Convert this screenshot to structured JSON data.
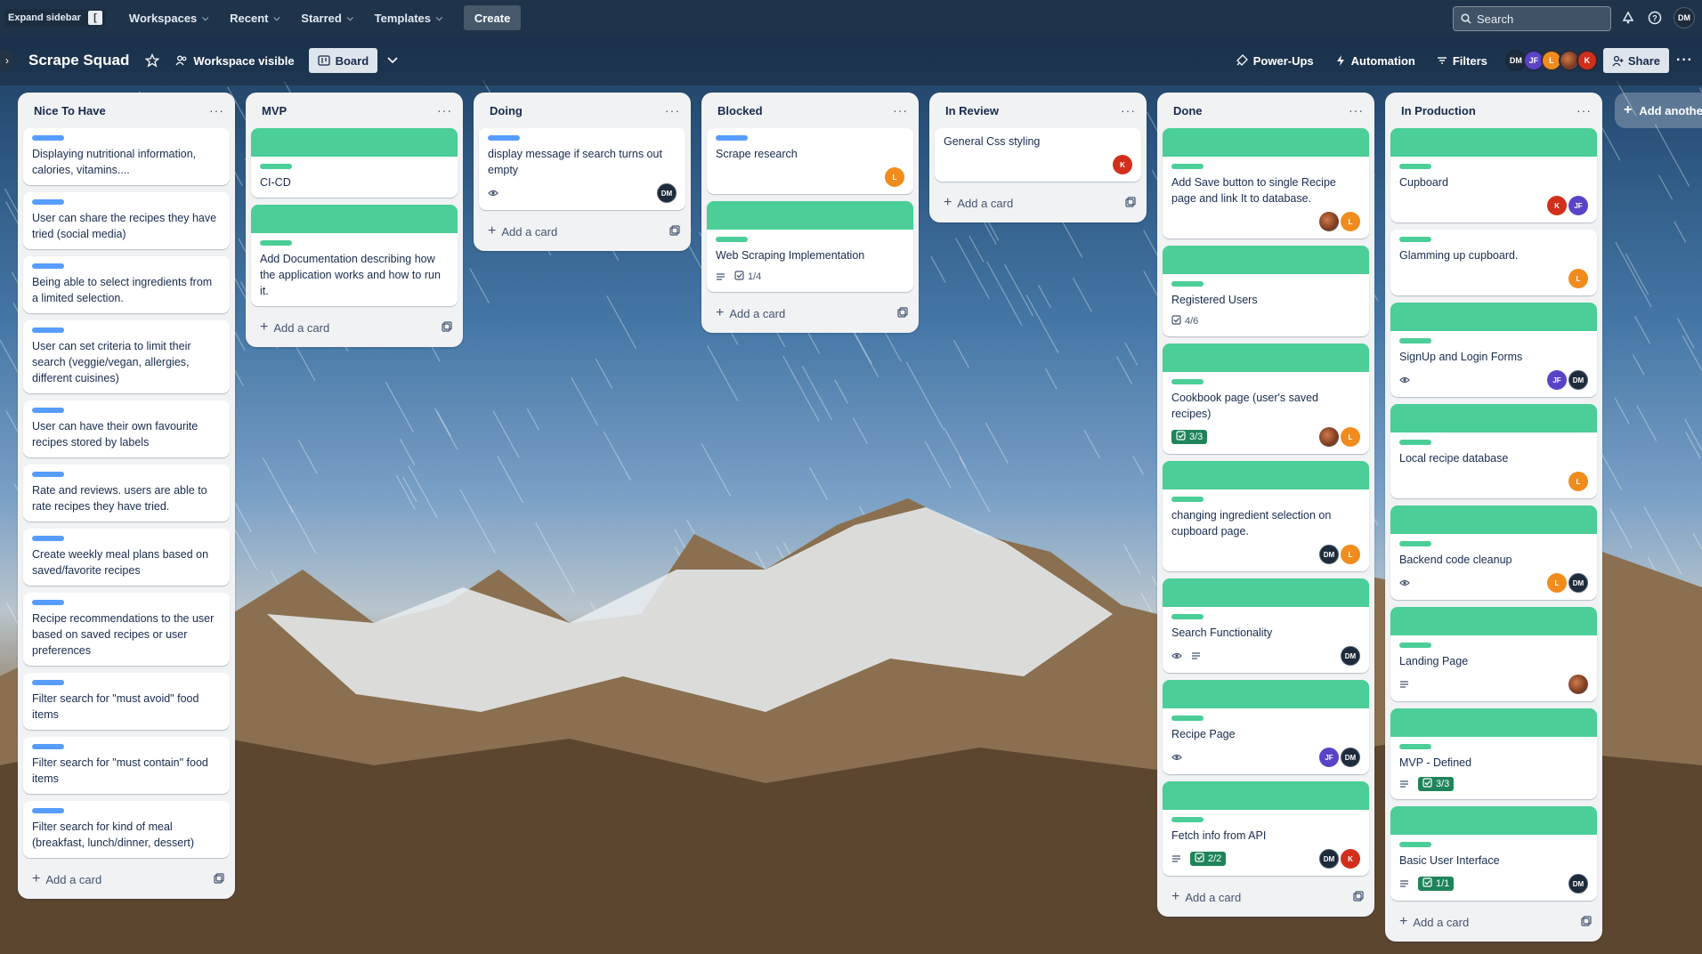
{
  "topbar": {
    "expand_sidebar": "Expand sidebar",
    "expand_key": "[",
    "nav": [
      {
        "label": "Workspaces"
      },
      {
        "label": "Recent"
      },
      {
        "label": "Starred"
      },
      {
        "label": "Templates"
      }
    ],
    "create": "Create",
    "search_placeholder": "Search",
    "user_initials": "DM"
  },
  "board": {
    "title": "Scrape Squad",
    "visibility": "Workspace visible",
    "view": "Board",
    "powerups": "Power-Ups",
    "automation": "Automation",
    "filters": "Filters",
    "share": "Share",
    "members": [
      "DM",
      "JF",
      "L",
      "",
      "K"
    ]
  },
  "colors": {
    "label_blue": "#579dff",
    "label_green": "#4bce97",
    "done_badge": "#1f845a",
    "list_bg": "#f1f2f4"
  },
  "add_another_list": "Add another list",
  "add_card_label": "Add a card",
  "lists": [
    {
      "title": "Nice To Have",
      "cards": [
        {
          "label": "blue",
          "text": "Displaying nutritional information, calories, vitamins...."
        },
        {
          "label": "blue",
          "text": "User can share the recipes they have tried (social media)"
        },
        {
          "label": "blue",
          "text": "Being able to select ingredients from a limited selection."
        },
        {
          "label": "blue",
          "text": "User can set criteria to limit their search (veggie/vegan, allergies, different cuisines)"
        },
        {
          "label": "blue",
          "text": "User can have their own favourite recipes stored by labels"
        },
        {
          "label": "blue",
          "text": "Rate and reviews. users are able to rate recipes they have tried."
        },
        {
          "label": "blue",
          "text": "Create weekly meal plans based on saved/favorite recipes"
        },
        {
          "label": "blue",
          "text": "Recipe recommendations to the user based on saved recipes or user preferences"
        },
        {
          "label": "blue",
          "text": "Filter search for \"must avoid\" food items"
        },
        {
          "label": "blue",
          "text": "Filter search for \"must contain\" food items"
        },
        {
          "label": "blue",
          "text": "Filter search for kind of meal (breakfast, lunch/dinner, dessert)"
        }
      ]
    },
    {
      "title": "MVP",
      "cards": [
        {
          "cover": true,
          "label": "green",
          "text": "CI-CD"
        },
        {
          "cover": true,
          "label": "green",
          "text": "Add Documentation describing how the application works and how to run it."
        }
      ]
    },
    {
      "title": "Doing",
      "cards": [
        {
          "label": "blue",
          "text": "display message if search turns out empty",
          "watch": true,
          "members": [
            "DM"
          ]
        }
      ]
    },
    {
      "title": "Blocked",
      "cards": [
        {
          "label": "blue",
          "text": "Scrape research",
          "members": [
            "L"
          ]
        },
        {
          "cover": true,
          "label": "green",
          "text": "Web Scraping Implementation",
          "desc": true,
          "checklist": "1/4"
        }
      ]
    },
    {
      "title": "In Review",
      "cards": [
        {
          "text": "General Css styling",
          "members": [
            "K"
          ]
        }
      ]
    },
    {
      "title": "Done",
      "cards": [
        {
          "cover": true,
          "label": "green",
          "text": "Add Save button to single Recipe page and link It to database.",
          "members": [
            "",
            "L"
          ]
        },
        {
          "cover": true,
          "label": "green",
          "text": "Registered Users",
          "checklist": "4/6"
        },
        {
          "cover": true,
          "label": "green",
          "text": "Cookbook page (user's saved recipes)",
          "checklist_done": "3/3",
          "members": [
            "",
            "L"
          ]
        },
        {
          "cover": true,
          "label": "green",
          "text": "changing ingredient selection on cupboard page.",
          "members": [
            "DM",
            "L"
          ]
        },
        {
          "cover": true,
          "label": "green",
          "text": "Search Functionality",
          "watch": true,
          "desc": true,
          "members": [
            "DM"
          ]
        },
        {
          "cover": true,
          "label": "green",
          "text": "Recipe Page",
          "watch": true,
          "members": [
            "JF",
            "DM"
          ]
        },
        {
          "cover": true,
          "label": "green",
          "text": "Fetch info from API",
          "desc": true,
          "checklist_done": "2/2",
          "members": [
            "DM",
            "K"
          ]
        }
      ]
    },
    {
      "title": "In Production",
      "cards": [
        {
          "cover": true,
          "label": "green",
          "text": "Cupboard",
          "members": [
            "K",
            "JF"
          ]
        },
        {
          "label": "green",
          "text": "Glamming up cupboard.",
          "members": [
            "L"
          ]
        },
        {
          "cover": true,
          "label": "green",
          "text": "SignUp and Login Forms",
          "watch": true,
          "members": [
            "JF",
            "DM"
          ]
        },
        {
          "cover": true,
          "label": "green",
          "text": "Local recipe database",
          "members": [
            "L"
          ]
        },
        {
          "cover": true,
          "label": "green",
          "text": "Backend code cleanup",
          "watch": true,
          "members": [
            "L",
            "DM"
          ]
        },
        {
          "cover": true,
          "label": "green",
          "text": "Landing Page",
          "desc": true,
          "members": [
            ""
          ]
        },
        {
          "cover": true,
          "label": "green",
          "text": "MVP - Defined",
          "desc": true,
          "checklist_done": "3/3"
        },
        {
          "cover": true,
          "label": "green",
          "text": "Basic User Interface",
          "desc": true,
          "checklist_done": "1/1",
          "members": [
            "DM"
          ]
        }
      ]
    }
  ]
}
